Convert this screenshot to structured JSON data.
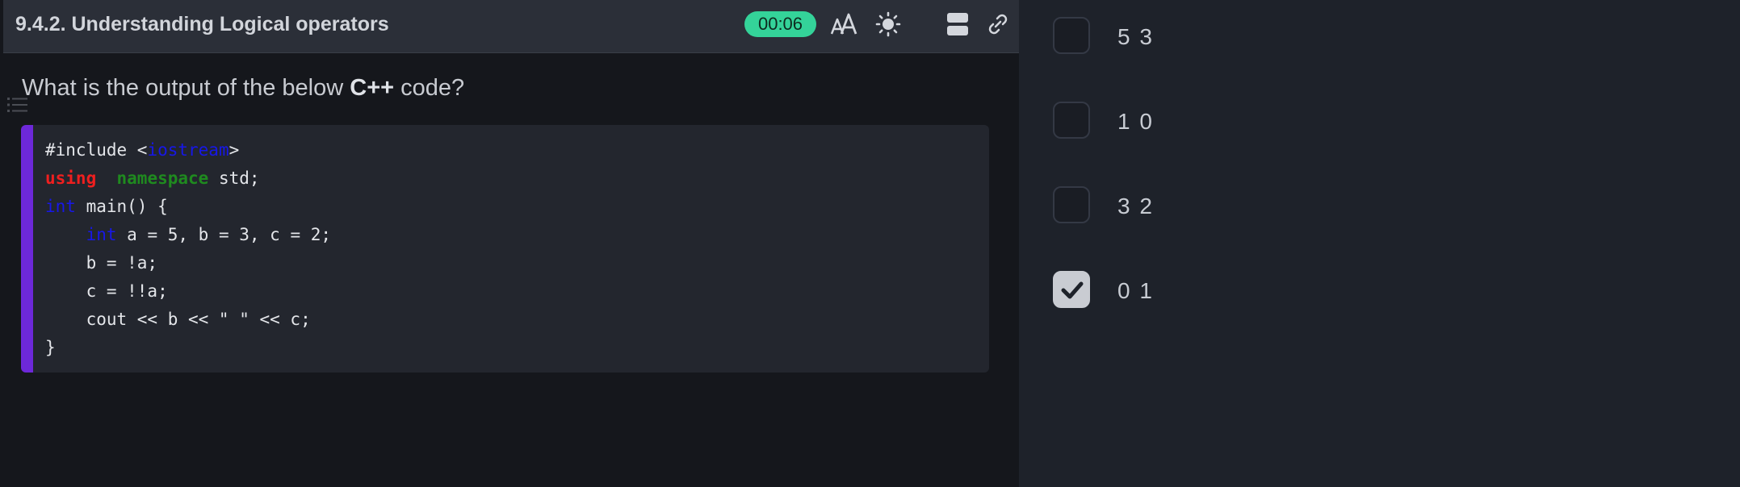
{
  "header": {
    "title": "9.4.2. Understanding Logical operators",
    "timer": "00:06"
  },
  "question": {
    "prefix": "What is the output of the below ",
    "emphasis": "C++",
    "suffix": " code?"
  },
  "code": {
    "line1_a": "#include <",
    "line1_b": "iostream",
    "line1_c": ">",
    "line2_a": "using",
    "line2_b": "namespace",
    "line2_c": " std;",
    "line3_a": "int",
    "line3_b": " main() {",
    "line4_indent": "    ",
    "line4_a": "int",
    "line4_b": " a = 5, b = 3, c = 2;",
    "line5": "    b = !a;",
    "line6": "    c = !!a;",
    "line7": "    cout << b << \" \" << c;",
    "line8": "}"
  },
  "options": [
    {
      "label": "5 3",
      "checked": false
    },
    {
      "label": "1 0",
      "checked": false
    },
    {
      "label": "3 2",
      "checked": false
    },
    {
      "label": "0 1",
      "checked": true
    }
  ],
  "colors": {
    "accent_bar": "#6d28d9",
    "timer_bg": "#34d399",
    "keyword_red": "#ef1f1f",
    "keyword_green": "#1f8a1f",
    "keyword_blue": "#1717e8"
  },
  "icons": {
    "font_size": "font-size-icon",
    "theme": "sun-icon",
    "layout": "layout-icon",
    "link": "link-icon",
    "sidebar": "list-icon",
    "check": "check-icon"
  }
}
